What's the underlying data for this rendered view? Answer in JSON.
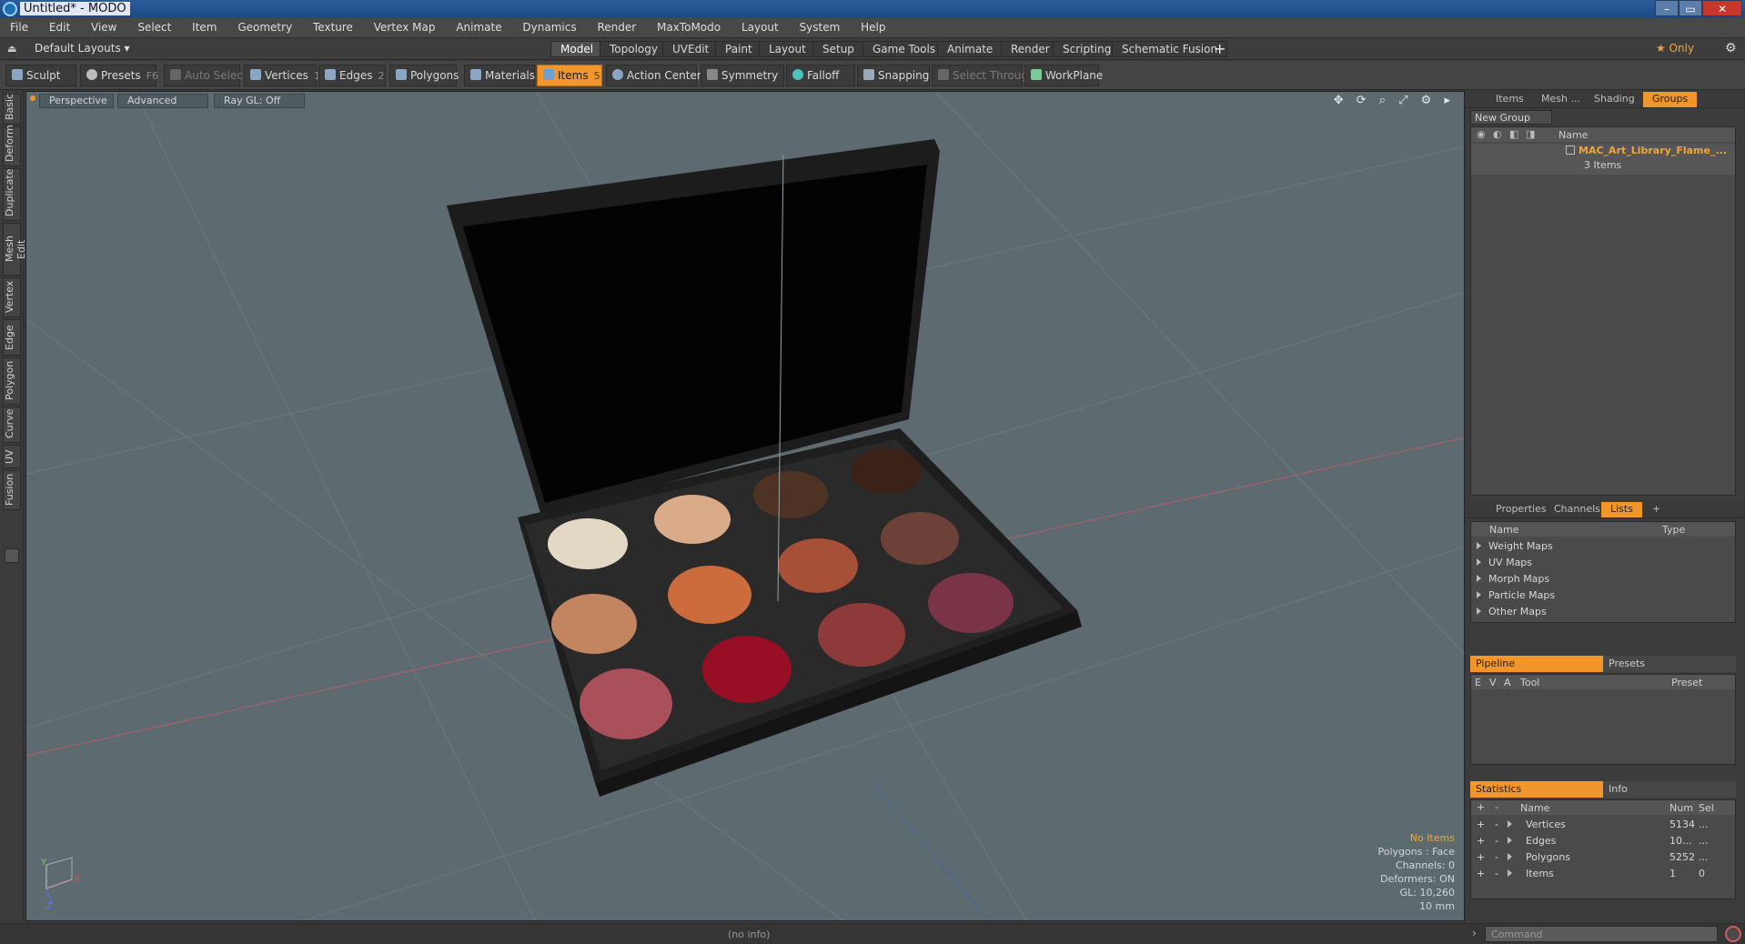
{
  "window": {
    "title": "Untitled* - MODO",
    "minimize": "–",
    "maximize": "▭",
    "close": "✕"
  },
  "menu": [
    "File",
    "Edit",
    "View",
    "Select",
    "Item",
    "Geometry",
    "Texture",
    "Vertex Map",
    "Animate",
    "Dynamics",
    "Render",
    "MaxToModo",
    "Layout",
    "System",
    "Help"
  ],
  "layoutbar": {
    "layout_dropdown": "Default Layouts ▾",
    "tabs": [
      "Model",
      "Topology",
      "UVEdit",
      "Paint",
      "Layout",
      "Setup",
      "Game Tools",
      "Animate",
      "Render",
      "Scripting",
      "Schematic Fusion"
    ],
    "active_tab": "Model",
    "add": "+",
    "only": "★  Only",
    "gear": "⚙"
  },
  "toolbar": {
    "sculpt": "Sculpt",
    "presets": "Presets",
    "presets_key": "F6",
    "auto_select": "Auto Select",
    "vertices": "Vertices",
    "vertices_key": "1",
    "edges": "Edges",
    "edges_key": "2",
    "polygons": "Polygons",
    "materials": "Materials",
    "items": "Items",
    "items_key": "5",
    "action_center": "Action Center",
    "symmetry": "Symmetry",
    "falloff": "Falloff",
    "snapping": "Snapping",
    "select_through": "Select Through",
    "workplane": "WorkPlane"
  },
  "lefttabs": [
    "Basic",
    "Deform",
    "Duplicate",
    "Mesh Edit",
    "Vertex",
    "Edge",
    "Polygon",
    "Curve",
    "UV",
    "Fusion"
  ],
  "viewport": {
    "perspective": "Perspective",
    "advanced": "Advanced",
    "raygl": "Ray GL: Off",
    "icons": "✥ ⟳ ⌕ ⤢ ⚙ ▸",
    "info": {
      "no_items": "No Items",
      "polygons": "Polygons : Face",
      "channels": "Channels: 0",
      "deformers": "Deformers: ON",
      "gl": "GL: 10,260",
      "scale": "10 mm"
    },
    "axis_y": "Y",
    "axis_x": "X",
    "axis_z": "Z"
  },
  "panel_top": {
    "tabs": [
      "Items",
      "Mesh ...",
      "Shading",
      "Groups"
    ],
    "active": "Groups",
    "new_group": "New Group",
    "col_name": "Name",
    "group_name": "MAC_Art_Library_Flame_...",
    "group_count": "3 Items"
  },
  "panel_mid": {
    "tabs": [
      "Properties",
      "Channels",
      "Lists"
    ],
    "active": "Lists",
    "add": "+",
    "col_name": "Name",
    "col_type": "Type",
    "items": [
      "Weight Maps",
      "UV Maps",
      "Morph Maps",
      "Particle Maps",
      "Other Maps"
    ]
  },
  "pipeline": {
    "tab_pipeline": "Pipeline",
    "tab_presets": "Presets",
    "cols": [
      "E",
      "V",
      "A",
      "Tool",
      "Preset"
    ]
  },
  "statistics": {
    "tab_stats": "Statistics",
    "tab_info": "Info",
    "col_plus": "+",
    "col_minus": "-",
    "col_name": "Name",
    "col_num": "Num",
    "col_sel": "Sel",
    "rows": [
      {
        "name": "Vertices",
        "num": "5134",
        "sel": "..."
      },
      {
        "name": "Edges",
        "num": "10...",
        "sel": "..."
      },
      {
        "name": "Polygons",
        "num": "5252",
        "sel": "..."
      },
      {
        "name": "Items",
        "num": "1",
        "sel": "0"
      }
    ]
  },
  "statusbar": {
    "info": "(no info)",
    "command_placeholder": "Command"
  },
  "colors": {
    "accent": "#f0962a",
    "viewport": "#5d6b71"
  }
}
